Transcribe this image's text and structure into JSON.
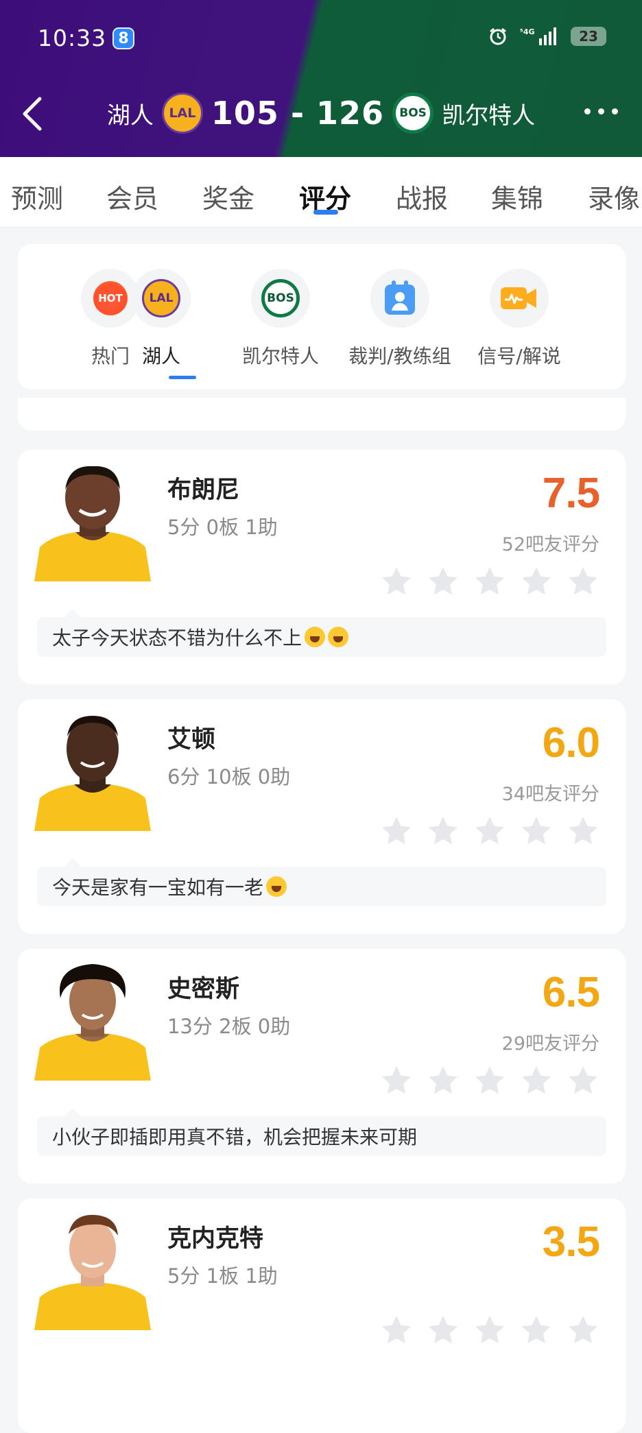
{
  "status_bar": {
    "time": "10:33",
    "badge": "8",
    "battery": "23"
  },
  "header": {
    "home_team": "湖人",
    "home_logo": "LAL",
    "score": "105 - 126",
    "away_logo": "BOS",
    "away_team": "凯尔特人",
    "colors": {
      "left": "#3d0e7a",
      "right": "#105a38"
    }
  },
  "tabs": [
    {
      "label": "预测"
    },
    {
      "label": "会员"
    },
    {
      "label": "奖金"
    },
    {
      "label": "评分",
      "active": true
    },
    {
      "label": "战报"
    },
    {
      "label": "集锦"
    },
    {
      "label": "录像"
    }
  ],
  "subnav": [
    {
      "label": "热门",
      "icon": "hot-icon",
      "icon_text": "HOT"
    },
    {
      "label": "湖人",
      "icon": "lakers-logo",
      "icon_text": "LAL",
      "active": true
    },
    {
      "label": "凯尔特人",
      "icon": "celtics-logo",
      "icon_text": "BOS"
    },
    {
      "label": "裁判/教练组",
      "icon": "referee-icon"
    },
    {
      "label": "信号/解说",
      "icon": "video-icon"
    }
  ],
  "players": [
    {
      "name": "布朗尼",
      "stats": "5分 0板 1助",
      "rating": "7.5",
      "rating_color": "#e8612c",
      "rating_count": "52吧友评分",
      "comment": "太子今天状态不错为什么不上",
      "emoji_count": 2
    },
    {
      "name": "艾顿",
      "stats": "6分 10板 0助",
      "rating": "6.0",
      "rating_color": "#f3a712",
      "rating_count": "34吧友评分",
      "comment": "今天是家有一宝如有一老",
      "emoji_count": 1
    },
    {
      "name": "史密斯",
      "stats": "13分 2板 0助",
      "rating": "6.5",
      "rating_color": "#f3a712",
      "rating_count": "29吧友评分",
      "comment": "小伙子即插即用真不错，机会把握未来可期",
      "emoji_count": 0
    },
    {
      "name": "克内克特",
      "stats": "5分 1板 1助",
      "rating": "3.5",
      "rating_color": "#f3a712"
    }
  ]
}
